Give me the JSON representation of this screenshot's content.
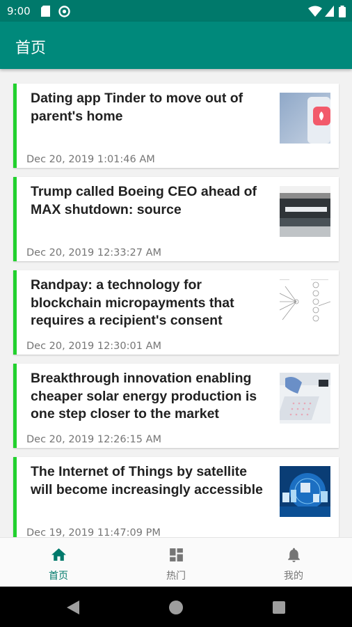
{
  "status_bar": {
    "time": "9:00"
  },
  "app_bar": {
    "title": "首页"
  },
  "articles": [
    {
      "title": "Dating app Tinder to move out of parent's home",
      "date": "Dec 20, 2019 1:01:46 AM"
    },
    {
      "title": "Trump called Boeing CEO ahead of MAX shutdown: source",
      "date": "Dec 20, 2019 12:33:27 AM"
    },
    {
      "title": "Randpay: a technology for blockchain micropayments that requires a recipient's consent",
      "date": "Dec 20, 2019 12:30:01 AM"
    },
    {
      "title": "Breakthrough innovation enabling cheaper solar energy production is one step closer to the market",
      "date": "Dec 20, 2019 12:26:15 AM"
    },
    {
      "title": "The Internet of Things by satellite will become increasingly accessible",
      "date": "Dec 19, 2019 11:47:09 PM"
    }
  ],
  "bottom_nav": [
    {
      "label": "首页",
      "icon": "home-icon",
      "active": true
    },
    {
      "label": "热门",
      "icon": "dashboard-icon",
      "active": false
    },
    {
      "label": "我的",
      "icon": "bell-icon",
      "active": false
    }
  ],
  "colors": {
    "primary": "#00897b",
    "primary_dark": "#00796b",
    "card_accent": "#22d12e"
  }
}
